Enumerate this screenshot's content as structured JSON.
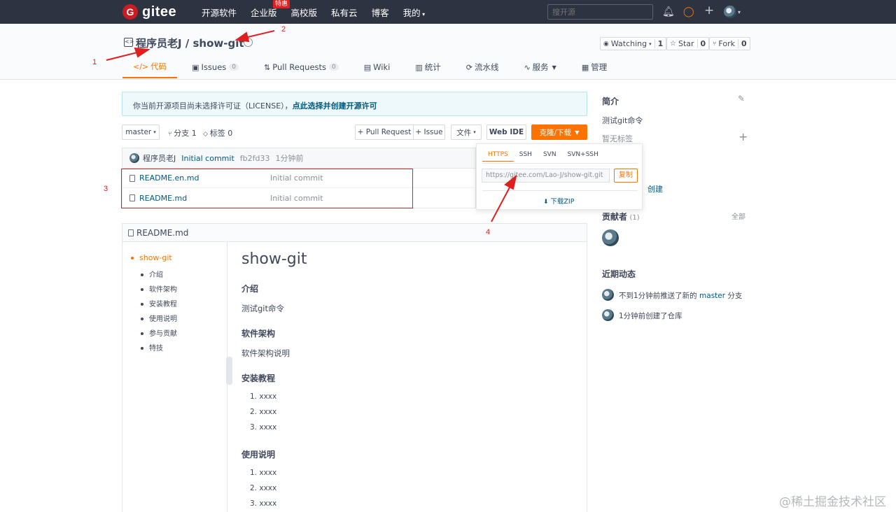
{
  "nav": {
    "brand": "gitee",
    "brand_mark": "G",
    "links": [
      "开源软件",
      "企业版",
      "高校版",
      "私有云",
      "博客",
      "我的"
    ],
    "badge": "特惠",
    "search_placeholder": "搜开源"
  },
  "repo": {
    "icon_label": "<>",
    "title": "程序员老J / show-git",
    "watching": {
      "label": "Watching",
      "count": "1"
    },
    "star": {
      "label": "Star",
      "count": "0"
    },
    "fork": {
      "label": "Fork",
      "count": "0"
    },
    "tabs": [
      {
        "label": "代码",
        "icon": "</>"
      },
      {
        "label": "Issues",
        "icon": "▣",
        "count": "0"
      },
      {
        "label": "Pull Requests",
        "icon": "⇅",
        "count": "0"
      },
      {
        "label": "Wiki",
        "icon": "▤"
      },
      {
        "label": "统计",
        "icon": "▥"
      },
      {
        "label": "流水线",
        "icon": "⟳"
      },
      {
        "label": "服务",
        "icon": "∿"
      },
      {
        "label": "管理",
        "icon": "▦"
      }
    ]
  },
  "notice": {
    "text": "你当前开源项目尚未选择许可证（LICENSE），",
    "link": "点此选择并创建开源许可"
  },
  "toolbar": {
    "branch": "master",
    "branches": "分支 1",
    "tags": "标签 0",
    "pull_request": "+ Pull Request",
    "issue": "+ Issue",
    "file": "文件",
    "web_ide": "Web IDE",
    "clone": "克隆/下载"
  },
  "commit": {
    "author": "程序员老J",
    "message": "Initial commit",
    "hash": "fb2fd33",
    "time": "1分钟前"
  },
  "files": [
    {
      "name": "README.en.md",
      "message": "Initial commit"
    },
    {
      "name": "README.md",
      "message": "Initial commit"
    }
  ],
  "readme": {
    "filename": "README.md",
    "toc": [
      "show-git",
      "介绍",
      "软件架构",
      "安装教程",
      "使用说明",
      "参与贡献",
      "特技"
    ],
    "h1": "show-git",
    "sections": {
      "intro_h": "介绍",
      "intro_p": "测试git命令",
      "arch_h": "软件架构",
      "arch_p": "软件架构说明",
      "install_h": "安装教程",
      "install_items": [
        "1. xxxx",
        "2. xxxx",
        "3. xxxx"
      ],
      "usage_h": "使用说明",
      "usage_items": [
        "1. xxxx",
        "2. xxxx",
        "3. xxxx"
      ]
    }
  },
  "sidebar": {
    "intro_title": "简介",
    "intro_text": "测试git命令",
    "no_tags": "暂无标签",
    "create": "创建",
    "contributors_title": "贡献者",
    "contributors_count": "(1)",
    "all": "全部",
    "activity_title": "近期动态",
    "activity_1_pre": "不到1分钟前推送了新的",
    "activity_1_branch": "master",
    "activity_1_post": "分支",
    "activity_2": "1分钟前创建了仓库"
  },
  "clone_panel": {
    "tabs": [
      "HTTPS",
      "SSH",
      "SVN",
      "SVN+SSH"
    ],
    "url": "https://gitee.com/Lao-J/show-git.git",
    "copy": "复制",
    "download": "下载ZIP"
  },
  "annotations": [
    "1",
    "2",
    "3",
    "4"
  ],
  "watermark": "@稀土掘金技术社区",
  "colors": {
    "accent": "#fe7300",
    "link": "#005980",
    "annotation": "#e02020",
    "nav_bg": "#2d3340"
  }
}
